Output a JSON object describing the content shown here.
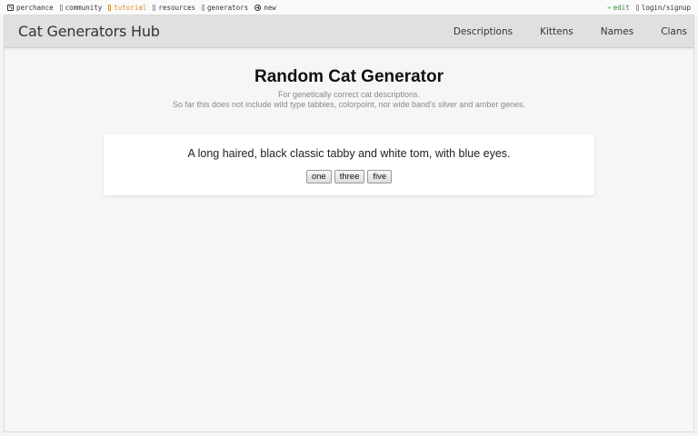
{
  "topbar": {
    "left_items": [
      {
        "label": "perchance",
        "icon": "dice-icon"
      },
      {
        "label": "community",
        "icon": "community-icon"
      },
      {
        "label": "tutorial",
        "icon": "tutorial-icon"
      },
      {
        "label": "resources",
        "icon": "resources-icon"
      },
      {
        "label": "generators",
        "icon": "generators-icon"
      },
      {
        "label": "new",
        "icon": "plus-icon"
      }
    ],
    "edit_label": "edit",
    "login_label": "login/signup",
    "colors": {
      "tutorial": "#e08a1e",
      "edit": "#2e8b2e"
    }
  },
  "navbar": {
    "brand": "Cat Generators Hub",
    "links": [
      "Descriptions",
      "Kittens",
      "Names",
      "Clans"
    ]
  },
  "main": {
    "title": "Random Cat Generator",
    "subtitle_1": "For genetically correct cat descriptions.",
    "subtitle_2": "So far this does not include wild type tabbies, colorpoint, nor wide band's silver and amber genes.",
    "output": "A long haired, black classic tabby and white tom, with blue eyes.",
    "buttons": [
      "one",
      "three",
      "five"
    ]
  }
}
